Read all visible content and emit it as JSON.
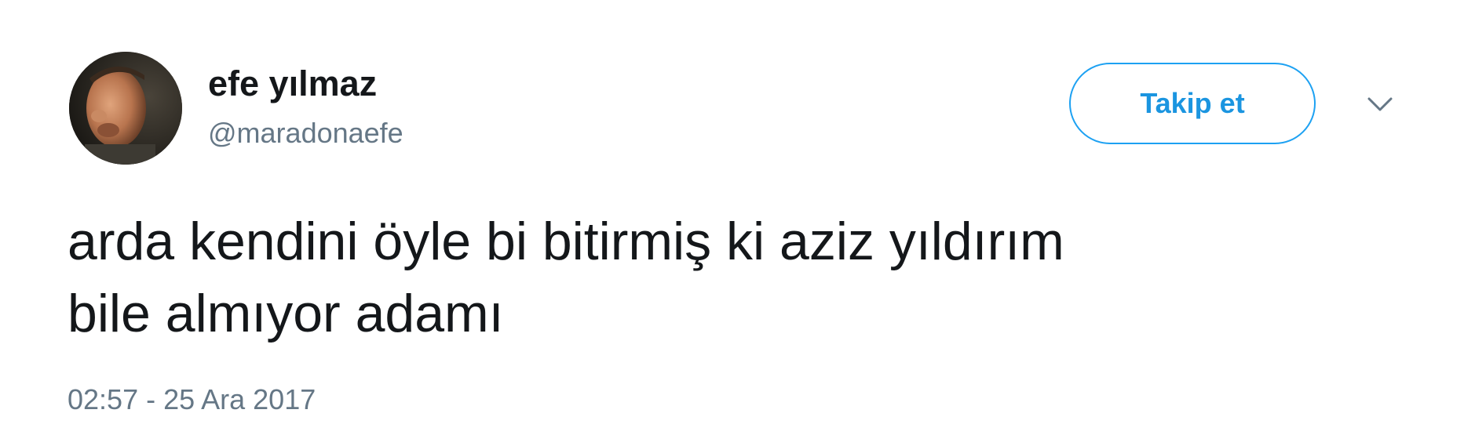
{
  "tweet": {
    "author": {
      "display_name": "efe yılmaz",
      "username": "@maradonaefe"
    },
    "follow_button_label": "Takip et",
    "text_lines": [
      "arda kendini öyle bi bitirmiş ki aziz yıldırım",
      "bile almıyor adamı"
    ],
    "timestamp": "02:57 - 25 Ara 2017",
    "icons": {
      "avatar": "profile-photo",
      "menu": "chevron-down-icon"
    },
    "colors": {
      "accent": "#1da1f2",
      "accent_text": "#1b95e0",
      "secondary_text": "#657786",
      "primary_text": "#14171a"
    }
  }
}
